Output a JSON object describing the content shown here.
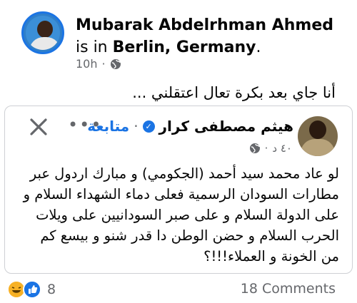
{
  "post": {
    "author": "Mubarak Abdelrhman Ahmed",
    "is_in": "is in",
    "location": "Berlin, Germany",
    "location_suffix": ".",
    "time": "10h",
    "dot": "·",
    "text": "أنا جاي بعد بكرة تعال اعتقلني ..."
  },
  "shared": {
    "author": "هيثم مصطفى كرار",
    "sep": "·",
    "follow": "متابعة",
    "time": "٤٠ د",
    "dot": "·",
    "body": "لو عاد محمد سيد أحمد (الجكومي) و مبارك اردول عبر مطارات السودان الرسمية فعلى دماء الشهداء السلام و على الدولة السلام و على صبر السودانيين على ويلات الحرب السلام و حضن الوطن دا قدر شنو و بيسع كم من الخونة و العملاء!!!؟"
  },
  "footer": {
    "reaction_count": "8",
    "comments": "18 Comments"
  },
  "icons": {
    "globe": "globe-icon",
    "close": "close-icon",
    "more": "more-icon",
    "verified": "verified-badge-icon",
    "haha": "haha-reaction-icon",
    "like": "like-reaction-icon"
  },
  "colors": {
    "accent": "#1b74e4",
    "secondary_text": "#65676b",
    "border": "#ced0d4"
  }
}
